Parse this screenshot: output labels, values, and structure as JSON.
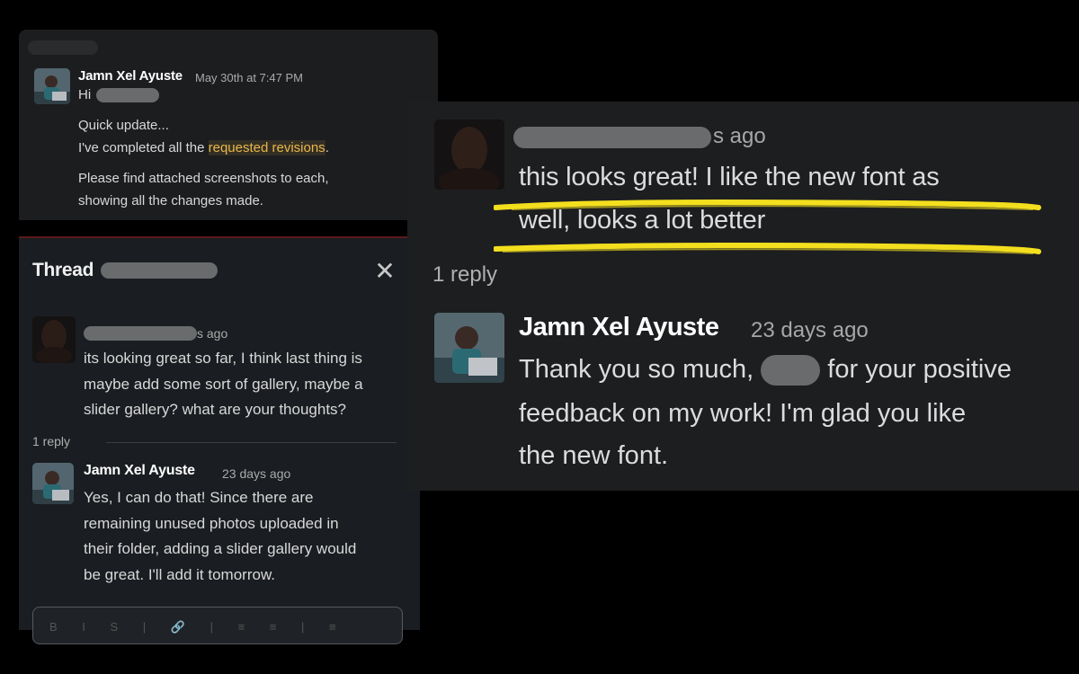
{
  "panel_a": {
    "author": "Jamn Xel Ayuste",
    "timestamp": "May 30th at 7:47 PM",
    "greeting": "Hi",
    "line1": "Quick update...",
    "line2_prefix": "I've completed all the ",
    "line2_highlight": "requested revisions",
    "line2_suffix": ".",
    "line3": "Please find attached screenshots to each,",
    "line4": "showing all the changes made."
  },
  "thread": {
    "title": "Thread",
    "close_glyph": "✕",
    "first_message": {
      "time_partial": "s ago",
      "lines": [
        "its looking great so far, I think last thing is",
        "maybe add some sort of gallery, maybe a",
        "slider gallery? what are your thoughts?"
      ]
    },
    "reply_count": "1 reply",
    "reply": {
      "author": "Jamn Xel Ayuste",
      "timestamp": "23 days ago",
      "lines": [
        "Yes, I can do that! Since there are",
        "remaining unused photos uploaded in",
        "their folder, adding a slider gallery would",
        "be great. I'll add it tomorrow."
      ]
    },
    "composer_tools": "B I S | 🔗 | ≡ ≡ | ≡"
  },
  "zoom": {
    "time_partial": "s ago",
    "message_line1": "this looks great! I like the new font as",
    "message_line2": "well, looks a lot better",
    "reply_count": "1 reply",
    "reply_author": "Jamn Xel Ayuste",
    "reply_timestamp": "23 days ago",
    "reply_line1_a": "Thank you so much,",
    "reply_line1_b": "for your positive",
    "reply_line2": "feedback on my work! I'm glad you like",
    "reply_line3": "the new font.",
    "underline_color": "#f3df1e"
  },
  "colors": {
    "highlight": "#e8b74a",
    "background": "#000000"
  }
}
